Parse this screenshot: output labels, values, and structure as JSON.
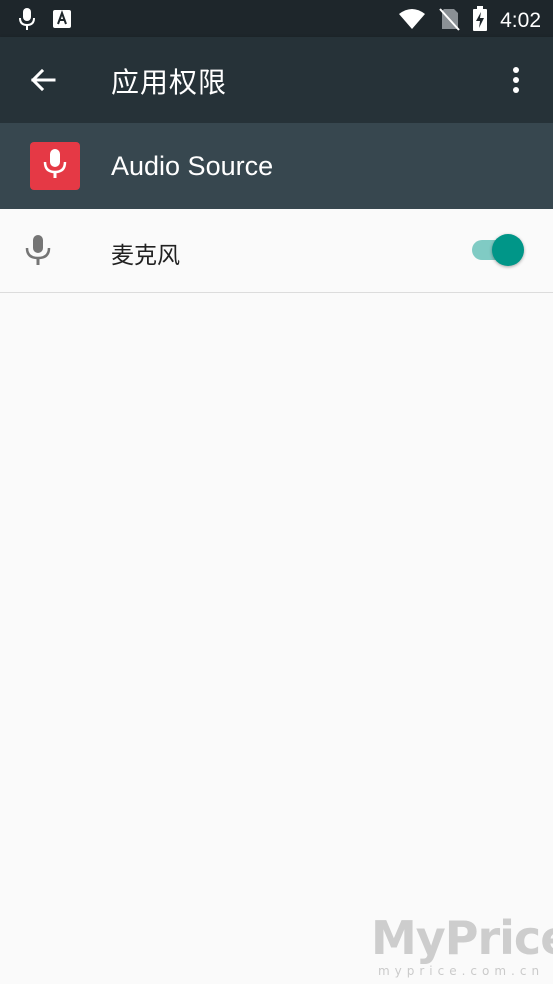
{
  "status_bar": {
    "time": "4:02",
    "icons": [
      "mic-icon",
      "font-download-icon",
      "wifi-icon",
      "no-sim-icon",
      "battery-charging-icon"
    ]
  },
  "app_bar": {
    "title": "应用权限",
    "back_icon": "arrow-back-icon",
    "overflow_icon": "more-vert-icon"
  },
  "app_header": {
    "app_name": "Audio Source",
    "app_icon": "mic-icon",
    "icon_color": "#e53945"
  },
  "permissions": [
    {
      "label": "麦克风",
      "icon": "mic-icon",
      "enabled": true
    }
  ],
  "colors": {
    "status_bar": "#1e262b",
    "app_bar": "#263238",
    "app_header": "#37474f",
    "toggle_on": "#009688",
    "toggle_track": "#80cbc4"
  },
  "watermark": {
    "main": "MyPrice",
    "sub": "myprice.com.cn"
  }
}
